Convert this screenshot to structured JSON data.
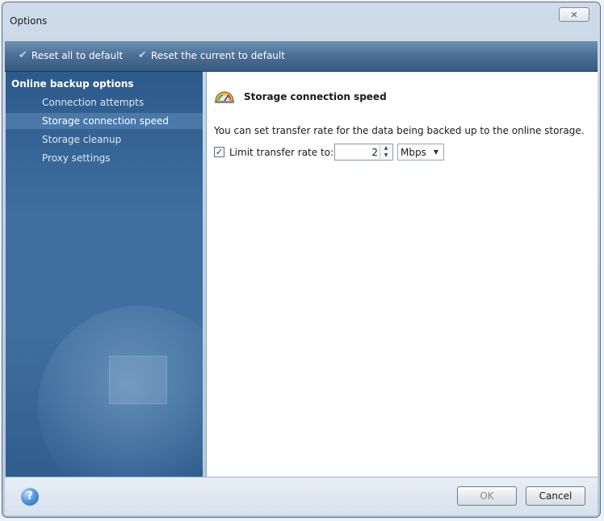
{
  "window": {
    "title": "Options",
    "close_glyph": "☒"
  },
  "toolbar": {
    "reset_all_label": "Reset all to default",
    "reset_current_label": "Reset the current to default",
    "check_icon": "check-icon"
  },
  "sidebar": {
    "heading": "Online backup options",
    "items": [
      {
        "label": "Connection attempts",
        "selected": false
      },
      {
        "label": "Storage connection speed",
        "selected": true
      },
      {
        "label": "Storage cleanup",
        "selected": false
      },
      {
        "label": "Proxy settings",
        "selected": false
      }
    ]
  },
  "content": {
    "title": "Storage connection speed",
    "description": "You can set transfer rate for the data being backed up to the online storage.",
    "limit": {
      "checked": true,
      "label": "Limit transfer rate to:",
      "value": "2",
      "unit": "Mbps"
    }
  },
  "footer": {
    "ok_label": "OK",
    "cancel_label": "Cancel",
    "help_icon": "help-icon"
  },
  "colors": {
    "toolbar": "#4e7196",
    "sidebar": "#3e6f9f",
    "selected_item": "#5f8cb9"
  }
}
